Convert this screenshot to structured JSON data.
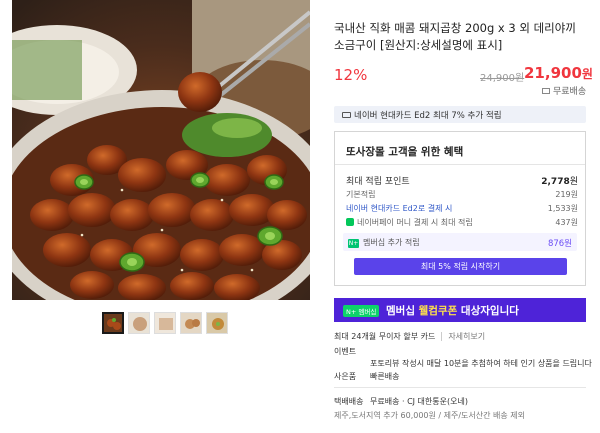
{
  "product": {
    "title": "국내산 직화 매콤 돼지곱창 200g x 3 외 데리야끼 소금구이 [원산지:상세설명에 표시]",
    "discount_rate": "12%",
    "original_price": "24,900원",
    "sale_price": "21,900",
    "sale_price_unit": "원",
    "shipping": "무료배송"
  },
  "card_promo": "네이버 현대카드 Ed2 최대 7% 추가 적립",
  "benefits": {
    "title": "또사장몰 고객을 위한 혜택",
    "max_points_label": "최대 적립 포인트",
    "max_points_value": "2,778",
    "max_points_unit": "원",
    "rows": [
      {
        "label": "기본적립",
        "value": "219원"
      },
      {
        "label": "네이버 현대카드 Ed2로 결제 시",
        "value": "1,533원"
      },
      {
        "label": "네이버페이 머니 결제 시 최대 적립",
        "value": "437원"
      }
    ],
    "member_badge": "N+",
    "member_label": "멤버십 추가 적립",
    "member_value": "876원",
    "member_button": "최대 5% 적립 시작하기"
  },
  "coupon": {
    "badge": "N+ 멤버십",
    "text_part1": "멤버십 ",
    "text_part2": "웰컴쿠폰",
    "text_part3": " 대상자입니다"
  },
  "installment": {
    "text": "최대 24개월 무이자 할부 카드",
    "more": "자세히보기"
  },
  "event": {
    "label": "이벤트",
    "text": "포토리뷰 작성시 매달 10분을 추첨하여 하테 인기 상품을 드립니다"
  },
  "gift": {
    "label": "사은품",
    "text": "빠른배송"
  },
  "delivery": {
    "label": "택배배송",
    "text": "무료배송 · CJ 대한통운(오네)",
    "extra": "제주,도서지역 추가 60,000원 / 제주/도서산간 배송 제외"
  },
  "colors": {
    "accent_red": "#f0363e",
    "membership_purple": "#5a43ea",
    "coupon_bg": "#4e23d8",
    "naver_green": "#03c75a"
  },
  "icons": {
    "shipping": "truck-icon",
    "card": "credit-card-icon",
    "npay": "naver-pay-icon"
  }
}
